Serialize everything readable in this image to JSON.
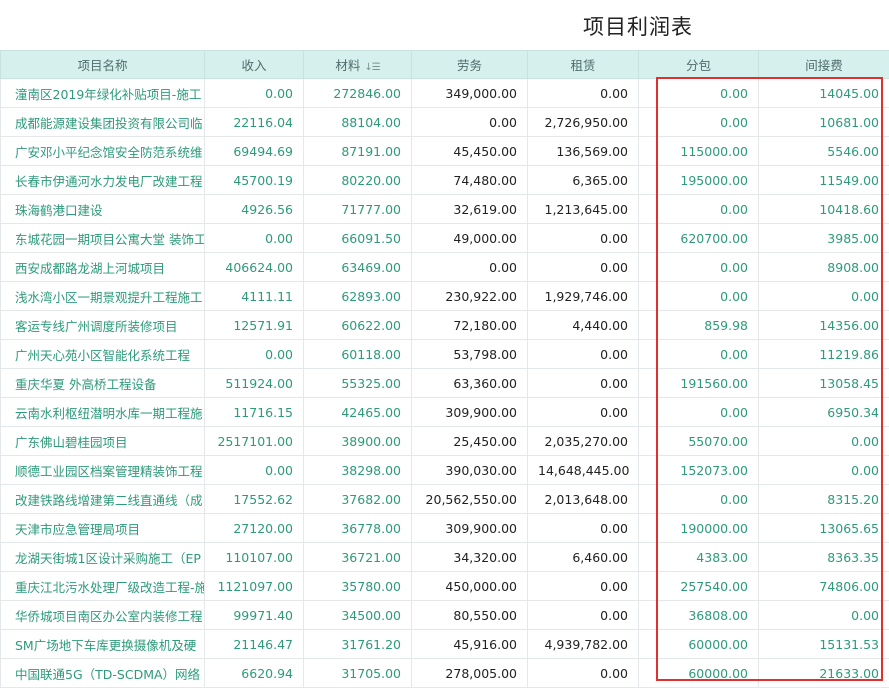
{
  "title": "项目利润表",
  "columns": [
    "项目名称",
    "收入",
    "材料",
    "劳务",
    "租赁",
    "分包",
    "间接费"
  ],
  "rows": [
    [
      "潼南区2019年绿化补贴项目-施工",
      "0.00",
      "272846.00",
      "349,000.00",
      "0.00",
      "0.00",
      "14045.00"
    ],
    [
      "成都能源建设集团投资有限公司临",
      "22116.04",
      "88104.00",
      "0.00",
      "2,726,950.00",
      "0.00",
      "10681.00"
    ],
    [
      "广安邓小平纪念馆安全防范系统维",
      "69494.69",
      "87191.00",
      "45,450.00",
      "136,569.00",
      "115000.00",
      "5546.00"
    ],
    [
      "长春市伊通河水力发电厂改建工程",
      "45700.19",
      "80220.00",
      "74,480.00",
      "6,365.00",
      "195000.00",
      "11549.00"
    ],
    [
      "珠海鹤港口建设",
      "4926.56",
      "71777.00",
      "32,619.00",
      "1,213,645.00",
      "0.00",
      "10418.60"
    ],
    [
      "东城花园一期项目公寓大堂 装饰工",
      "0.00",
      "66091.50",
      "49,000.00",
      "0.00",
      "620700.00",
      "3985.00"
    ],
    [
      "西安成都路龙湖上河城项目",
      "406624.00",
      "63469.00",
      "0.00",
      "0.00",
      "0.00",
      "8908.00"
    ],
    [
      "浅水湾小区一期景观提升工程施工",
      "4111.11",
      "62893.00",
      "230,922.00",
      "1,929,746.00",
      "0.00",
      "0.00"
    ],
    [
      "客运专线广州调度所装修项目",
      "12571.91",
      "60622.00",
      "72,180.00",
      "4,440.00",
      "859.98",
      "14356.00"
    ],
    [
      "广州天心苑小区智能化系统工程",
      "0.00",
      "60118.00",
      "53,798.00",
      "0.00",
      "0.00",
      "11219.86"
    ],
    [
      "重庆华夏 外高桥工程设备",
      "511924.00",
      "55325.00",
      "63,360.00",
      "0.00",
      "191560.00",
      "13058.45"
    ],
    [
      "云南水利枢纽潜明水库一期工程施",
      "11716.15",
      "42465.00",
      "309,900.00",
      "0.00",
      "0.00",
      "6950.34"
    ],
    [
      "广东佛山碧桂园项目",
      "2517101.00",
      "38900.00",
      "25,450.00",
      "2,035,270.00",
      "55070.00",
      "0.00"
    ],
    [
      "顺德工业园区档案管理精装饰工程",
      "0.00",
      "38298.00",
      "390,030.00",
      "14,648,445.00",
      "152073.00",
      "0.00"
    ],
    [
      "改建铁路线增建第二线直通线（成",
      "17552.62",
      "37682.00",
      "20,562,550.00",
      "2,013,648.00",
      "0.00",
      "8315.20"
    ],
    [
      "天津市应急管理局项目",
      "27120.00",
      "36778.00",
      "309,900.00",
      "0.00",
      "190000.00",
      "13065.65"
    ],
    [
      "龙湖天街城1区设计采购施工（EP",
      "110107.00",
      "36721.00",
      "34,320.00",
      "6,460.00",
      "4383.00",
      "8363.35"
    ],
    [
      "重庆江北污水处理厂级改造工程-施",
      "1121097.00",
      "35780.00",
      "450,000.00",
      "0.00",
      "257540.00",
      "74806.00"
    ],
    [
      "华侨城项目南区办公室内装修工程",
      "99971.40",
      "34500.00",
      "80,550.00",
      "0.00",
      "36808.00",
      "0.00"
    ],
    [
      "SM广场地下车库更换摄像机及硬",
      "21146.47",
      "31761.20",
      "45,916.00",
      "4,939,782.00",
      "60000.00",
      "15131.53"
    ],
    [
      "中国联通5G（TD-SCDMA）网络",
      "6620.94",
      "31705.00",
      "278,005.00",
      "0.00",
      "60000.00",
      "21633.00"
    ]
  ],
  "colors": {
    "header_bg": "#d6f0ee",
    "teal_text": "#2d9a7a",
    "dark_text": "#222222",
    "highlight_border": "#e03030"
  },
  "icons": {
    "sort": "sort-icon"
  }
}
